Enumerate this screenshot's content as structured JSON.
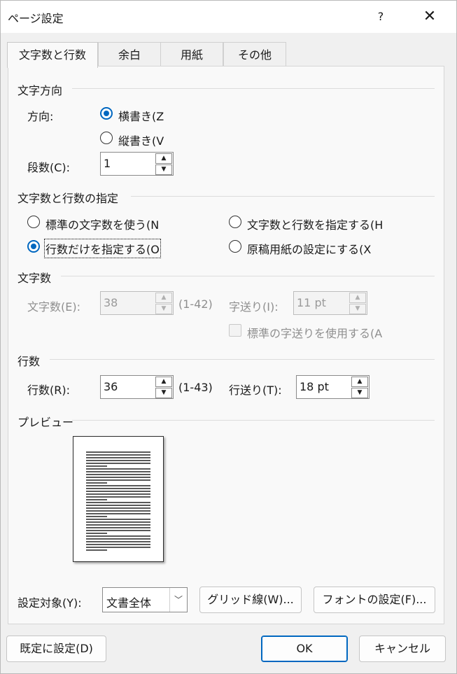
{
  "window": {
    "title": "ページ設定",
    "help": "?",
    "close": "✕"
  },
  "tabs": [
    "文字数と行数",
    "余白",
    "用紙",
    "その他"
  ],
  "orientation": {
    "group_title": "文字方向",
    "label": "方向:",
    "horizontal": "横書き(Z",
    "vertical": "縦書き(V",
    "selected": "horizontal"
  },
  "columns": {
    "label": "段数(C):",
    "value": "1"
  },
  "grid_spec": {
    "group_title": "文字数と行数の指定",
    "opt_standard": "標準の文字数を使う(N",
    "opt_lines_only": "行数だけを指定する(O",
    "opt_chars_lines": "文字数と行数を指定する(H",
    "opt_manuscript": "原稿用紙の設定にする(X",
    "selected": "lines_only"
  },
  "chars": {
    "group_title": "文字数",
    "label": "文字数(E):",
    "value": "38",
    "range": "(1-42)",
    "pitch_label": "字送り(I):",
    "pitch_value": "11 pt",
    "use_standard_pitch": "標準の字送りを使用する(A"
  },
  "lines": {
    "group_title": "行数",
    "label": "行数(R):",
    "value": "36",
    "range": "(1-43)",
    "pitch_label": "行送り(T):",
    "pitch_value": "18 pt"
  },
  "preview": {
    "group_title": "プレビュー"
  },
  "apply_to": {
    "label": "設定対象(Y):",
    "value": "文書全体"
  },
  "buttons": {
    "gridlines": "グリッド線(W)...",
    "font": "フォントの設定(F)...",
    "set_default": "既定に設定(D)",
    "ok": "OK",
    "cancel": "キャンセル"
  },
  "icons": {
    "spin_up": "▲",
    "spin_down": "▼",
    "combo_down": "﹀"
  }
}
